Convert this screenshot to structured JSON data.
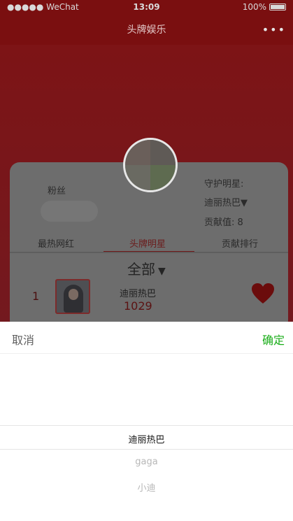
{
  "status": {
    "left": "●●●●● WeChat",
    "wifi": "wifi-icon",
    "time": "13:09",
    "battery_text": "100%"
  },
  "nav": {
    "title": "头牌娱乐",
    "more": "•••"
  },
  "card": {
    "fans_label": "粉丝",
    "guard_label": "守护明星:",
    "guard_star": "迪丽热巴▼",
    "contribution": "贡献值: 8",
    "tabs": [
      "最热网红",
      "头牌明星",
      "贡献排行"
    ],
    "filter": "全部",
    "filter_caret": "▼",
    "row": {
      "rank": "1",
      "name": "迪丽热巴",
      "score": "1029"
    }
  },
  "picker": {
    "cancel": "取消",
    "confirm": "确定",
    "options": [
      "迪丽热巴",
      "gaga",
      "小迪"
    ]
  }
}
